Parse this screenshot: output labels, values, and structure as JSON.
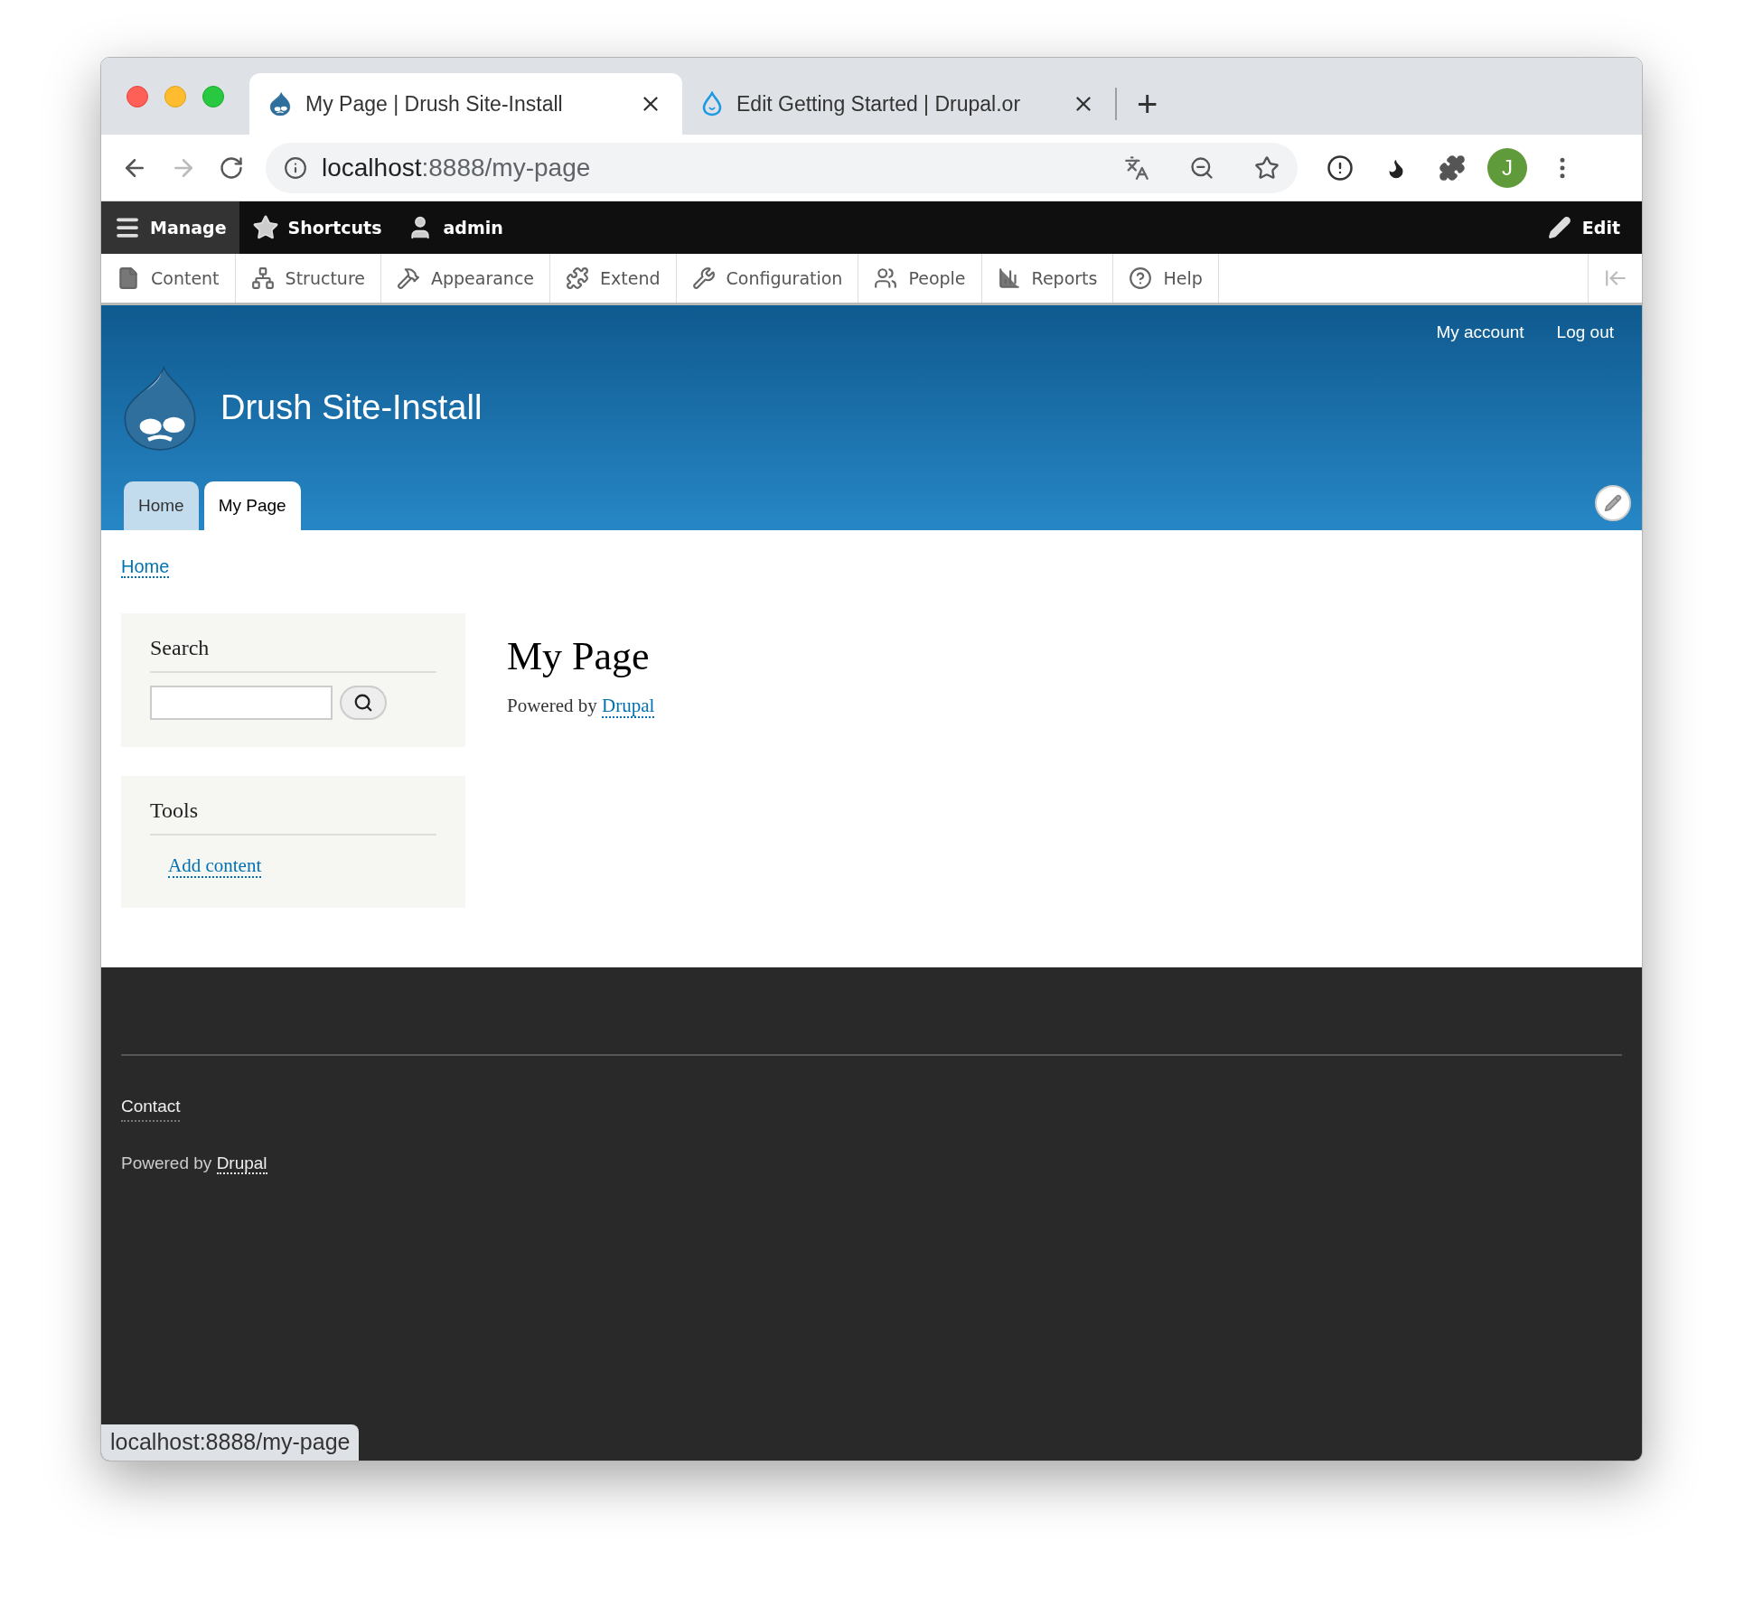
{
  "browser": {
    "tabs": [
      {
        "title": "My Page | Drush Site-Install",
        "selected": true
      },
      {
        "title": "Edit Getting Started | Drupal.or",
        "selected": false
      }
    ],
    "new_tab": "+",
    "url": {
      "host": "localhost",
      "path": ":8888/my-page"
    },
    "profile_initial": "J"
  },
  "admin_toolbar": {
    "items": [
      {
        "label": "Manage",
        "selected": true
      },
      {
        "label": "Shortcuts",
        "selected": false
      },
      {
        "label": "admin",
        "selected": false
      }
    ],
    "edit": "Edit"
  },
  "tray": {
    "items": [
      {
        "label": "Content"
      },
      {
        "label": "Structure"
      },
      {
        "label": "Appearance"
      },
      {
        "label": "Extend"
      },
      {
        "label": "Configuration"
      },
      {
        "label": "People"
      },
      {
        "label": "Reports"
      },
      {
        "label": "Help"
      }
    ]
  },
  "header": {
    "user_links": [
      "My account",
      "Log out"
    ],
    "site_name": "Drush Site-Install",
    "tabs": [
      {
        "label": "Home",
        "selected": false
      },
      {
        "label": "My Page",
        "selected": true
      }
    ]
  },
  "breadcrumb": [
    "Home"
  ],
  "sidebar": [
    {
      "kind": "search",
      "title": "Search"
    },
    {
      "kind": "links",
      "title": "Tools",
      "links": [
        "Add content"
      ]
    }
  ],
  "content": {
    "title": "My Page",
    "powered_prefix": "Powered by",
    "powered_link": "Drupal"
  },
  "footer": {
    "links": [
      "Contact"
    ],
    "powered_prefix": "Powered by",
    "powered_link": "Drupal"
  },
  "status_bar": {
    "url": "localhost:8888/my-page"
  }
}
